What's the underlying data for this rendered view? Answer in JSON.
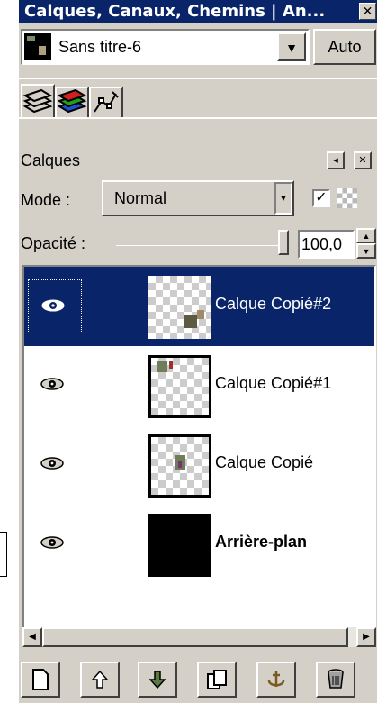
{
  "window": {
    "title": "Calques, Canaux, Chemins | An..."
  },
  "image_selector": {
    "value": "Sans titre-6",
    "auto_label": "Auto"
  },
  "tabs": [
    {
      "name": "layers-tab-icon"
    },
    {
      "name": "channels-tab-icon"
    },
    {
      "name": "paths-tab-icon"
    }
  ],
  "layers_panel": {
    "title": "Calques",
    "mode_label": "Mode :",
    "mode_value": "Normal",
    "opacity_label": "Opacité :",
    "opacity_value": "100,0",
    "opacity_fraction": 1.0
  },
  "layers": [
    {
      "name": "Calque Copié#2",
      "selected": true,
      "visible": true,
      "bold": false
    },
    {
      "name": "Calque Copié#1",
      "selected": false,
      "visible": true,
      "bold": false
    },
    {
      "name": "Calque Copié",
      "selected": false,
      "visible": true,
      "bold": false
    },
    {
      "name": "Arrière-plan",
      "selected": false,
      "visible": true,
      "bold": true
    }
  ],
  "bottom_buttons": [
    "new-layer-icon",
    "raise-layer-icon",
    "lower-layer-icon",
    "duplicate-layer-icon",
    "anchor-layer-icon",
    "delete-layer-icon"
  ],
  "colors": {
    "selection": "#0a246a",
    "face": "#d4d0c8"
  }
}
